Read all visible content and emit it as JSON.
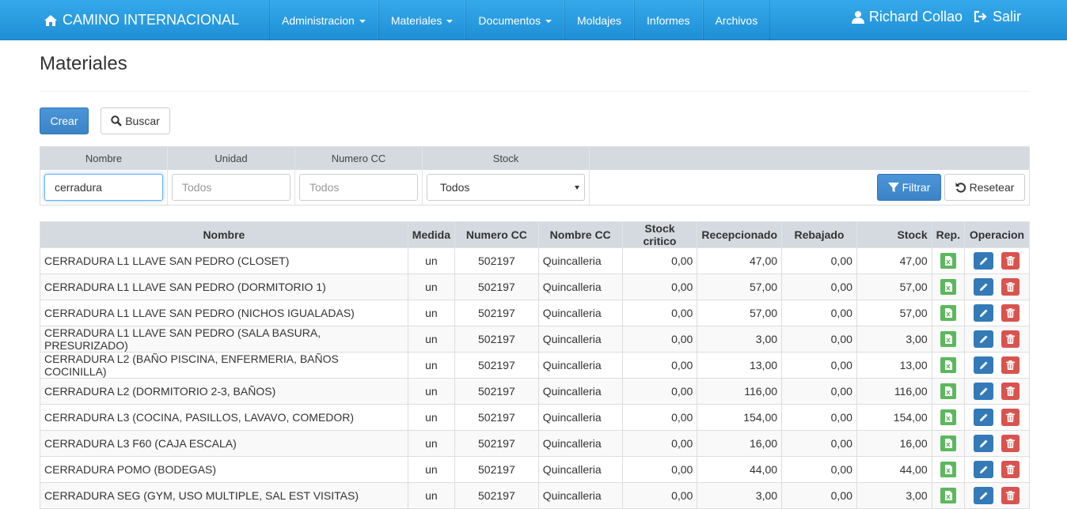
{
  "navbar": {
    "brand": "CAMINO INTERNACIONAL",
    "items": [
      {
        "label": "Administracion",
        "dropdown": true
      },
      {
        "label": "Materiales",
        "dropdown": true
      },
      {
        "label": "Documentos",
        "dropdown": true
      },
      {
        "label": "Moldajes",
        "dropdown": false
      },
      {
        "label": "Informes",
        "dropdown": false
      },
      {
        "label": "Archivos",
        "dropdown": false
      }
    ],
    "user": "Richard Collao",
    "logout": "Salir"
  },
  "page": {
    "title": "Materiales",
    "create_label": "Crear",
    "search_label": "Buscar"
  },
  "filter": {
    "headers": [
      "Nombre",
      "Unidad",
      "Numero CC",
      "Stock"
    ],
    "nombre_value": "cerradura",
    "unidad_placeholder": "Todos",
    "numero_cc_placeholder": "Todos",
    "stock_selected": "Todos",
    "filter_label": "Filtrar",
    "reset_label": "Resetear"
  },
  "table": {
    "columns": [
      "Nombre",
      "Medida",
      "Numero CC",
      "Nombre CC",
      "Stock critico",
      "Recepcionado",
      "Rebajado",
      "Stock",
      "Rep.",
      "Operacion"
    ],
    "rows": [
      {
        "nombre": "CERRADURA L1 LLAVE SAN PEDRO (CLOSET)",
        "medida": "un",
        "numero_cc": "502197",
        "nombre_cc": "Quincalleria",
        "stock_critico": "0,00",
        "recepcionado": "47,00",
        "rebajado": "0,00",
        "stock": "47,00"
      },
      {
        "nombre": "CERRADURA L1 LLAVE SAN PEDRO (DORMITORIO 1)",
        "medida": "un",
        "numero_cc": "502197",
        "nombre_cc": "Quincalleria",
        "stock_critico": "0,00",
        "recepcionado": "57,00",
        "rebajado": "0,00",
        "stock": "57,00"
      },
      {
        "nombre": "CERRADURA L1 LLAVE SAN PEDRO (NICHOS IGUALADAS)",
        "medida": "un",
        "numero_cc": "502197",
        "nombre_cc": "Quincalleria",
        "stock_critico": "0,00",
        "recepcionado": "57,00",
        "rebajado": "0,00",
        "stock": "57,00"
      },
      {
        "nombre": "CERRADURA L1 LLAVE SAN PEDRO (SALA BASURA, PRESURIZADO)",
        "medida": "un",
        "numero_cc": "502197",
        "nombre_cc": "Quincalleria",
        "stock_critico": "0,00",
        "recepcionado": "3,00",
        "rebajado": "0,00",
        "stock": "3,00"
      },
      {
        "nombre": "CERRADURA L2 (BAÑO PISCINA, ENFERMERIA, BAÑOS COCINILLA)",
        "medida": "un",
        "numero_cc": "502197",
        "nombre_cc": "Quincalleria",
        "stock_critico": "0,00",
        "recepcionado": "13,00",
        "rebajado": "0,00",
        "stock": "13,00"
      },
      {
        "nombre": "CERRADURA L2 (DORMITORIO 2-3, BAÑOS)",
        "medida": "un",
        "numero_cc": "502197",
        "nombre_cc": "Quincalleria",
        "stock_critico": "0,00",
        "recepcionado": "116,00",
        "rebajado": "0,00",
        "stock": "116,00"
      },
      {
        "nombre": "CERRADURA L3 (COCINA, PASILLOS, LAVAVO, COMEDOR)",
        "medida": "un",
        "numero_cc": "502197",
        "nombre_cc": "Quincalleria",
        "stock_critico": "0,00",
        "recepcionado": "154,00",
        "rebajado": "0,00",
        "stock": "154,00"
      },
      {
        "nombre": "CERRADURA L3 F60 (CAJA ESCALA)",
        "medida": "un",
        "numero_cc": "502197",
        "nombre_cc": "Quincalleria",
        "stock_critico": "0,00",
        "recepcionado": "16,00",
        "rebajado": "0,00",
        "stock": "16,00"
      },
      {
        "nombre": "CERRADURA POMO (BODEGAS)",
        "medida": "un",
        "numero_cc": "502197",
        "nombre_cc": "Quincalleria",
        "stock_critico": "0,00",
        "recepcionado": "44,00",
        "rebajado": "0,00",
        "stock": "44,00"
      },
      {
        "nombre": "CERRADURA SEG (GYM, USO MULTIPLE, SAL EST VISITAS)",
        "medida": "un",
        "numero_cc": "502197",
        "nombre_cc": "Quincalleria",
        "stock_critico": "0,00",
        "recepcionado": "3,00",
        "rebajado": "0,00",
        "stock": "3,00"
      }
    ],
    "row_icons": {
      "report": "excel-file-icon",
      "edit": "pencil-icon",
      "delete": "trash-icon"
    }
  },
  "colors": {
    "navbar": "#2a9de2",
    "primary": "#3b84c6",
    "success": "#5cb85c",
    "danger": "#d9534f",
    "header_bg": "#d4dadf"
  }
}
